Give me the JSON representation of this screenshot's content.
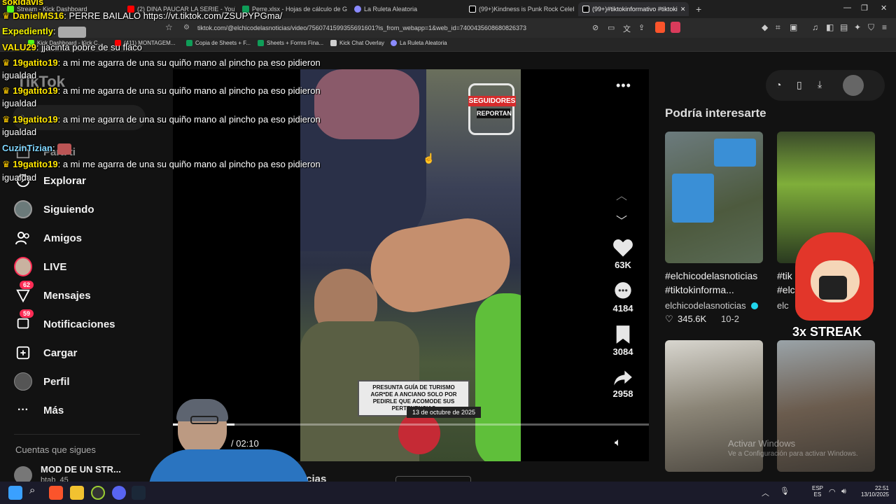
{
  "browser": {
    "tabs": [
      {
        "label": "Stream - Kick Dashboard",
        "color": "#53fc18"
      },
      {
        "label": "(2) DINA PAUCAR LA SERIE - YouTube",
        "color": "#ff0000"
      },
      {
        "label": "Perre.xlsx - Hojas de cálculo de Goog",
        "color": "#0f9d58"
      },
      {
        "label": "La Ruleta Aleatoria",
        "color": "#8a8aff"
      },
      {
        "label": "(99+)Kindness is Punk Rock Celebrat",
        "color": "#ffffff"
      },
      {
        "label": "(99+)#tiktokinformativo #tiktoki",
        "color": "#ffffff"
      }
    ],
    "close_tab": "✕",
    "new_tab": "+",
    "url": "tiktok.com/@elchicodelasnoticias/video/7560741599355691601?is_from_webapp=1&web_id=7400435608680826373",
    "bookmarks": [
      {
        "label": "Kick Dashboard - Kick C..."
      },
      {
        "label": "(411) MONTAGEM..."
      },
      {
        "label": "Copia de Sheets + F..."
      },
      {
        "label": "Sheets + Forms Fina..."
      },
      {
        "label": "Kick Chat Overlay"
      },
      {
        "label": "La Ruleta Aleatoria"
      }
    ]
  },
  "tiktok": {
    "logo": "TikTok",
    "nav": [
      {
        "label": "Para ti",
        "icon": "home-icon"
      },
      {
        "label": "Explorar",
        "icon": "compass-icon"
      },
      {
        "label": "Siguiendo",
        "icon": "avatar"
      },
      {
        "label": "Amigos",
        "icon": "people-icon"
      },
      {
        "label": "LIVE",
        "icon": "live-icon"
      },
      {
        "label": "Mensajes",
        "icon": "message-icon",
        "badge": "62"
      },
      {
        "label": "Notificaciones",
        "icon": "bell-icon",
        "badge": "59"
      },
      {
        "label": "Cargar",
        "icon": "plus-icon"
      },
      {
        "label": "Perfil",
        "icon": "avatar"
      },
      {
        "label": "Más",
        "icon": "more-icon"
      }
    ],
    "following_header": "Cuentas que sigues",
    "following_account": {
      "name": "MOD DE UN STR...",
      "handle": "btab_45"
    },
    "video": {
      "badge_line1": "SEGUIDORES",
      "badge_line2": "REPORTAN",
      "caption": "PRESUNTA GUÍA DE TURISMO AGR*DE A ANCIANO SOLO POR PEDIRLE QUE ACOMODE SUS PERTENENCIAS",
      "date": "13 de octubre de 2025",
      "time": "/ 02:10",
      "progress": 0.13,
      "author_fragment": "ticias"
    },
    "actions": {
      "likes": "63K",
      "comments": "4184",
      "saves": "3084",
      "shares": "2958"
    },
    "recommend_header": "Podría interesarte",
    "recos": [
      {
        "title": "#elchicodelasnoticias #tiktokinforma...",
        "user": "elchicodelasnoticias",
        "likes": "345.6K",
        "date": "10-2"
      },
      {
        "title": "#tik #elc",
        "user": "elc",
        "likes": "",
        "date": ""
      }
    ],
    "reco_overlay_text": "3x STREAK",
    "activate_windows": "Activar Windows",
    "activate_windows_sub": "Ve a Configuración para activar Windows."
  },
  "chat": [
    {
      "user": "sokidavis",
      "text": ""
    },
    {
      "user": "DanielMS16",
      "text": "PERRE BAILALO https://vt.tiktok.com/ZSUPYPGma/"
    },
    {
      "user": "Expediently",
      "text": ""
    },
    {
      "user": "VALU29",
      "text": "jjacinta pobre de su flaco"
    },
    {
      "user": "19gatito19",
      "text": "a mi me agarra de una su quiño mano al pincho pa eso pidieron"
    },
    {
      "user": "",
      "text": "igualdad"
    },
    {
      "user": "19gatito19",
      "text": "a mi me agarra de una su quiño mano al pincho pa eso pidieron"
    },
    {
      "user": "",
      "text": "igualdad"
    },
    {
      "user": "19gatito19",
      "text": "a mi me agarra de una su quiño mano al pincho pa eso pidieron"
    },
    {
      "user": "",
      "text": "igualdad"
    },
    {
      "user": "CuzinTizian",
      "text": ""
    },
    {
      "user": "19gatito19",
      "text": "a mi me agarra de una su quiño mano al pincho pa eso pidieron"
    },
    {
      "user": "",
      "text": "igualdad"
    }
  ],
  "taskbar": {
    "lang1": "ESP",
    "lang2": "ES",
    "time": "22:51",
    "date": "13/10/2025"
  }
}
